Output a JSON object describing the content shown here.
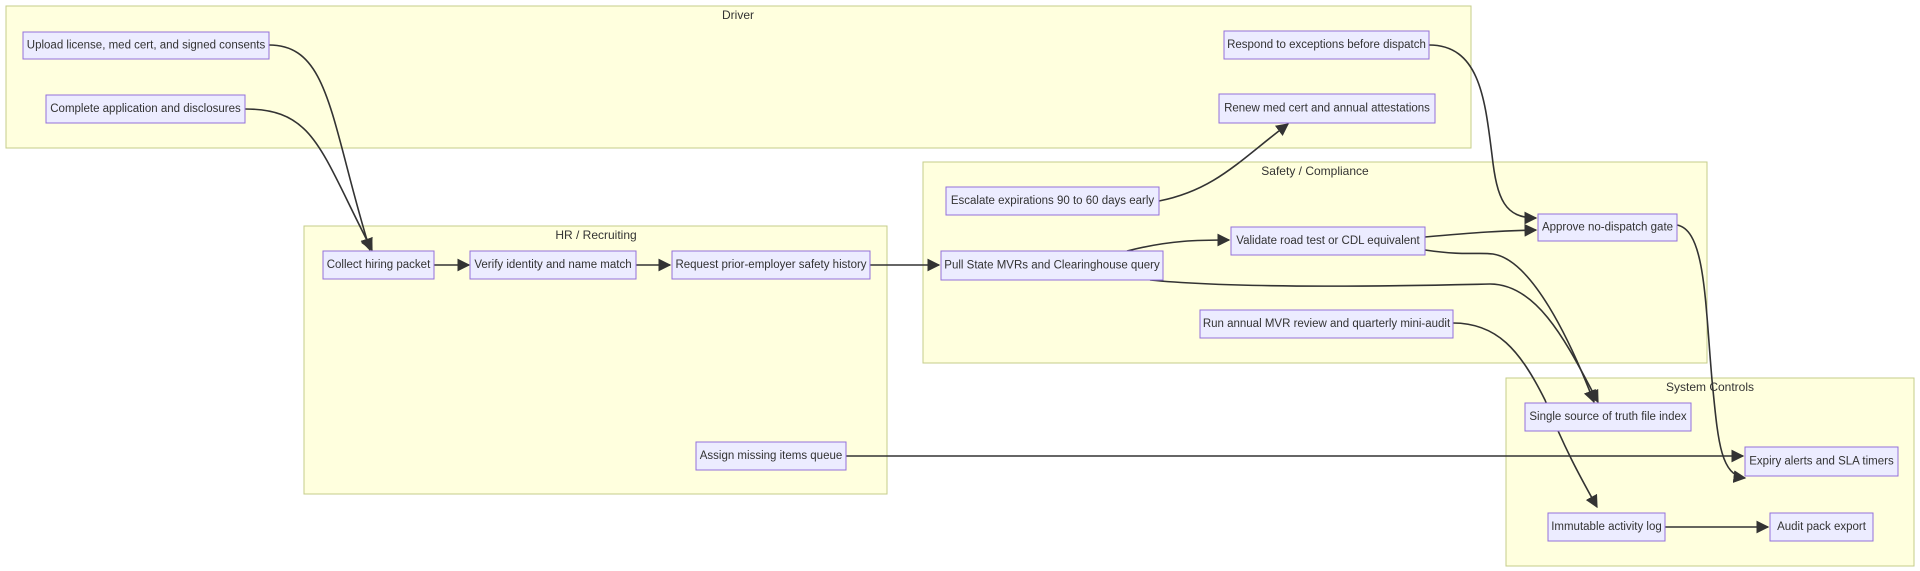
{
  "lanes": {
    "driver": "Driver",
    "hr": "HR / Recruiting",
    "safety": "Safety / Compliance",
    "system": "System Controls"
  },
  "nodes": {
    "upload_docs": "Upload license, med cert, and signed consents",
    "complete_app": "Complete application and disclosures",
    "respond_exceptions": "Respond to exceptions before dispatch",
    "renew_medcert": "Renew med cert and annual attestations",
    "collect_packet": "Collect hiring packet",
    "verify_identity": "Verify identity and name match",
    "request_history": "Request prior-employer safety history",
    "assign_missing": "Assign missing items queue",
    "escalate_expirations": "Escalate expirations 90 to 60 days early",
    "pull_mvrs": "Pull State MVRs and Clearinghouse query",
    "validate_road_test": "Validate road test or CDL equivalent",
    "approve_gate": "Approve no-dispatch gate",
    "annual_review": "Run annual MVR review and quarterly mini-audit",
    "file_index": "Single source of truth file index",
    "expiry_alerts": "Expiry alerts and SLA timers",
    "activity_log": "Immutable activity log",
    "audit_export": "Audit pack export"
  }
}
